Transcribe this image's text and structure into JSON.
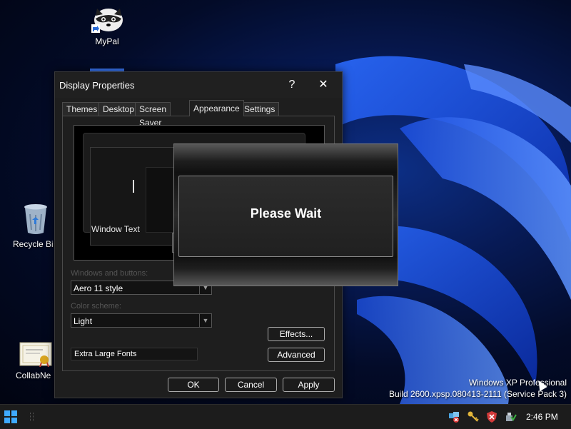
{
  "desktop": {
    "icons": [
      {
        "label": "MyPal"
      },
      {
        "label": "Recycle Bi"
      },
      {
        "label": "CollabNe"
      }
    ]
  },
  "dialog": {
    "title": "Display Properties",
    "help": "?",
    "close": "✕",
    "tabs": [
      "Themes",
      "Desktop",
      "Screen Saver",
      "Appearance",
      "Settings"
    ],
    "active_tab": "Appearance",
    "preview": {
      "window_text": "Window Text"
    },
    "windows_buttons": {
      "label": "Windows and buttons:",
      "value": "Aero 11 style"
    },
    "color_scheme": {
      "label": "Color scheme:",
      "value": "Light"
    },
    "font_size": {
      "value": "Extra Large Fonts"
    },
    "effects_label": "Effects...",
    "advanced_label": "Advanced",
    "ok_label": "OK",
    "cancel_label": "Cancel",
    "apply_label": "Apply"
  },
  "wait_dialog": {
    "message": "Please Wait"
  },
  "watermark": {
    "line1": "Windows XP Professional",
    "line2": "Build 2600.xpsp.080413-2111 (Service Pack 3)"
  },
  "taskbar": {
    "clock": "2:46 PM"
  }
}
